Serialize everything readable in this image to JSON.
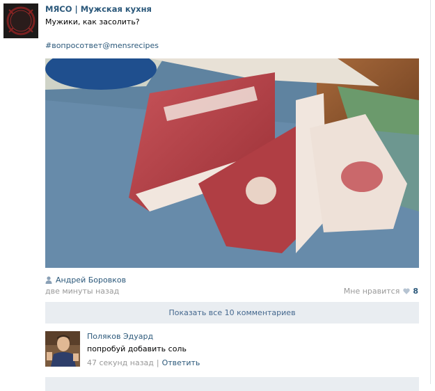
{
  "post": {
    "group_name": "МЯСО | Мужская кухня",
    "avatar_logo_text": "МЯСО",
    "text": "Мужики, как засолить?",
    "hashtags": [
      "#вопросответ",
      "@mensrecipes"
    ],
    "photo_icon": "raw-pork-photo",
    "author": "Андрей Боровков",
    "author_icon": "user-icon",
    "time": "две минуты назад",
    "like_label": "Мне нравится",
    "like_icon": "heart-icon",
    "like_count": "8"
  },
  "comments": {
    "show_all_label": "Показать все 10 комментариев",
    "items": [
      {
        "author": "Поляков Эдуард",
        "text": "попробуй добавить соль",
        "time": "47 секунд назад",
        "separator": "|",
        "reply_label": "Ответить"
      }
    ]
  },
  "colors": {
    "link": "#2b587a",
    "muted": "#999999",
    "button_bg": "#e9edf1",
    "button_text": "#45688e"
  }
}
